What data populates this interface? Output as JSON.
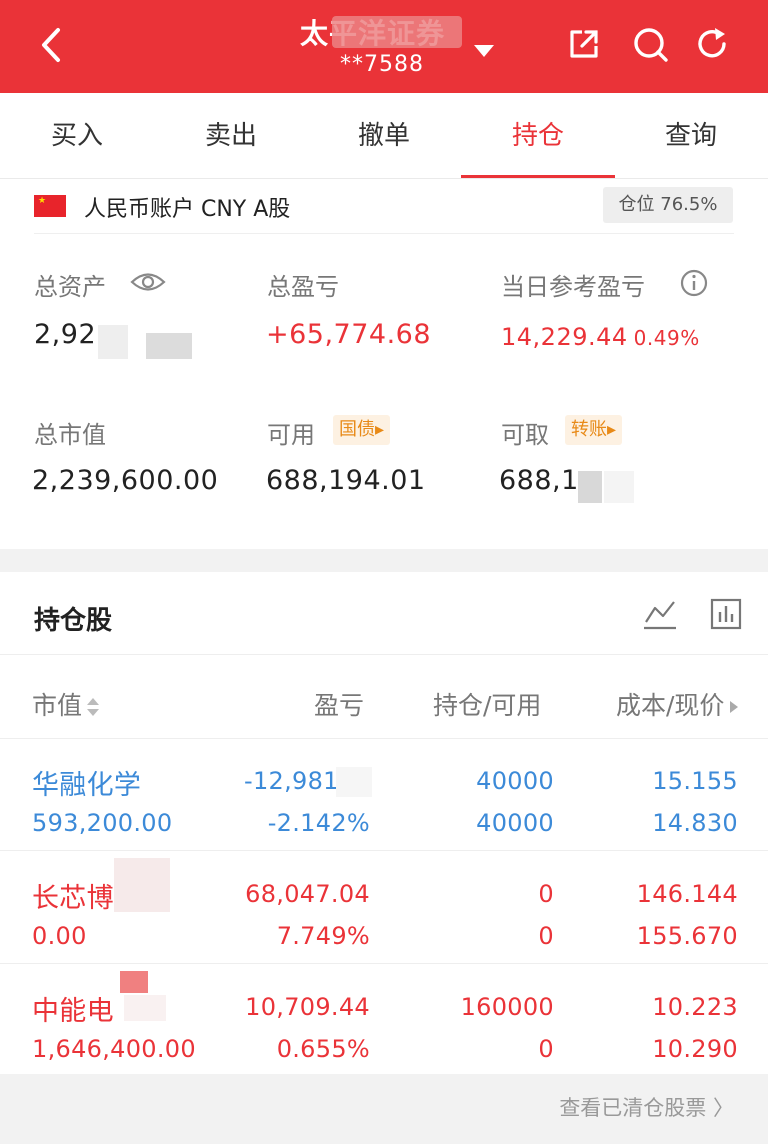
{
  "header": {
    "title": "太平洋证券",
    "account": "**7588",
    "colors": {
      "bg": "#ea3338"
    }
  },
  "tabs": [
    {
      "label": "买入"
    },
    {
      "label": "卖出"
    },
    {
      "label": "撤单"
    },
    {
      "label": "持仓",
      "active": true
    },
    {
      "label": "查询"
    }
  ],
  "summary": {
    "account_label": "人民币账户 CNY A股",
    "position_ratio": "仓位 76.5%",
    "total_assets_label": "总资产",
    "total_assets_value": "2,92",
    "total_pnl_label": "总盈亏",
    "total_pnl_value": "+65,774.68",
    "daily_pnl_label": "当日参考盈亏",
    "daily_pnl_value": "14,229.44",
    "daily_pnl_pct": "0.49%",
    "market_value_label": "总市值",
    "market_value_value": "2,239,600.00",
    "available_label": "可用",
    "available_tag": "国债▸",
    "available_value": "688,194.01",
    "withdrawable_label": "可取",
    "withdrawable_tag": "转账▸",
    "withdrawable_value": "688,1"
  },
  "holdings": {
    "title": "持仓股",
    "columns": [
      "市值",
      "盈亏",
      "持仓/可用",
      "成本/现价"
    ],
    "rows": [
      {
        "name": "华融化学",
        "market_value": "593,200.00",
        "pnl": "-12,981",
        "pnl_pct": "-2.142%",
        "position": "40000",
        "available": "40000",
        "cost": "15.155",
        "price": "14.830",
        "tone": "blue"
      },
      {
        "name": "长芯博",
        "market_value": "0.00",
        "pnl": "68,047.04",
        "pnl_pct": "7.749%",
        "position": "0",
        "available": "0",
        "cost": "146.144",
        "price": "155.670",
        "tone": "red"
      },
      {
        "name": "中能电",
        "market_value": "1,646,400.00",
        "pnl": "10,709.44",
        "pnl_pct": "0.655%",
        "position": "160000",
        "available": "0",
        "cost": "10.223",
        "price": "10.290",
        "tone": "red"
      }
    ]
  },
  "footer": {
    "cleared_link": "查看已清仓股票 〉"
  }
}
